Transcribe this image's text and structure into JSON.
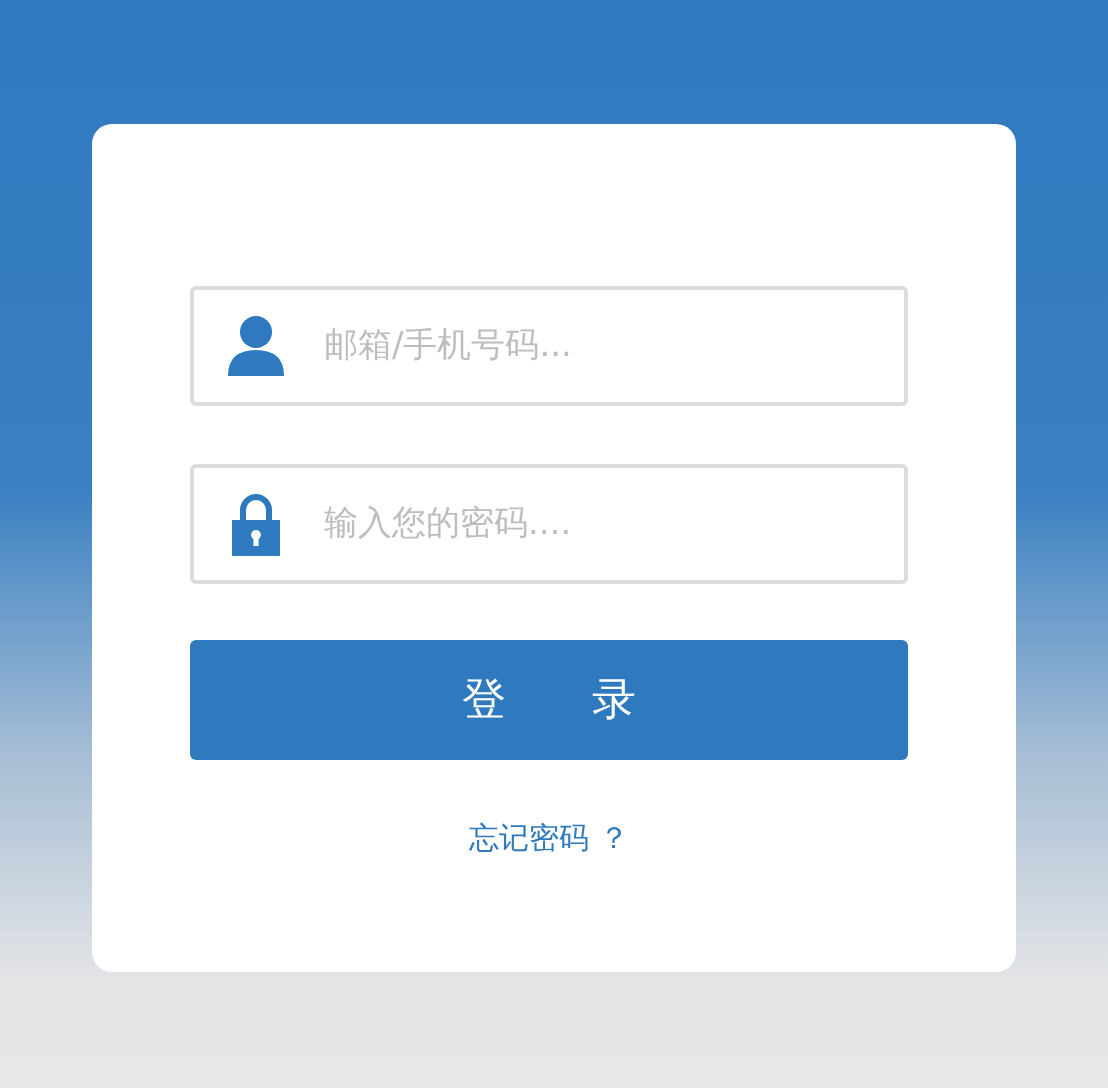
{
  "login_form": {
    "fields": [
      {
        "kind": "user",
        "placeholder": "邮箱/手机号码..."
      },
      {
        "kind": "password",
        "placeholder": "输入您的密码...."
      }
    ],
    "submit_button": "登 录",
    "forgot_link": "忘记密码 ？"
  }
}
